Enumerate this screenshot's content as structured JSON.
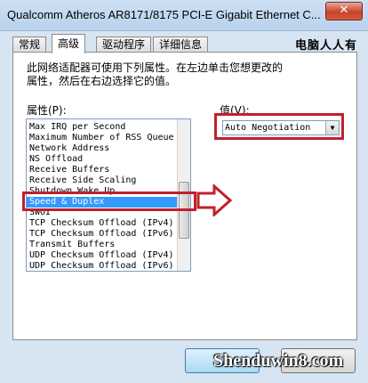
{
  "window": {
    "title": "Qualcomm Atheros AR8171/8175 PCI-E Gigabit Ethernet C...",
    "close_glyph": "✕"
  },
  "tabs": [
    "常规",
    "高级",
    "驱动程序",
    "详细信息"
  ],
  "active_tab": "高级",
  "watermark_top": "电脑人人有",
  "description": "此网络适配器可使用下列属性。在左边单击您想更改的属性，然后在右边选择它的值。",
  "property_label": "属性(P):",
  "value_label": "值(V):",
  "properties": [
    "Max IRQ per Second",
    "Maximum Number of RSS Queue",
    "Network Address",
    "NS Offload",
    "Receive Buffers",
    "Receive Side Scaling",
    "Shutdown Wake Up",
    "Speed & Duplex",
    "SWOI",
    "TCP Checksum Offload (IPv4)",
    "TCP Checksum Offload (IPv6)",
    "Transmit Buffers",
    "UDP Checksum Offload (IPv4)",
    "UDP Checksum Offload (IPv6)"
  ],
  "selected_property": "Speed & Duplex",
  "value_selected": "Auto Negotiation",
  "site_watermark": "Shenduwin8.com",
  "colors": {
    "highlight": "#c0202e",
    "selection": "#3399ff"
  }
}
